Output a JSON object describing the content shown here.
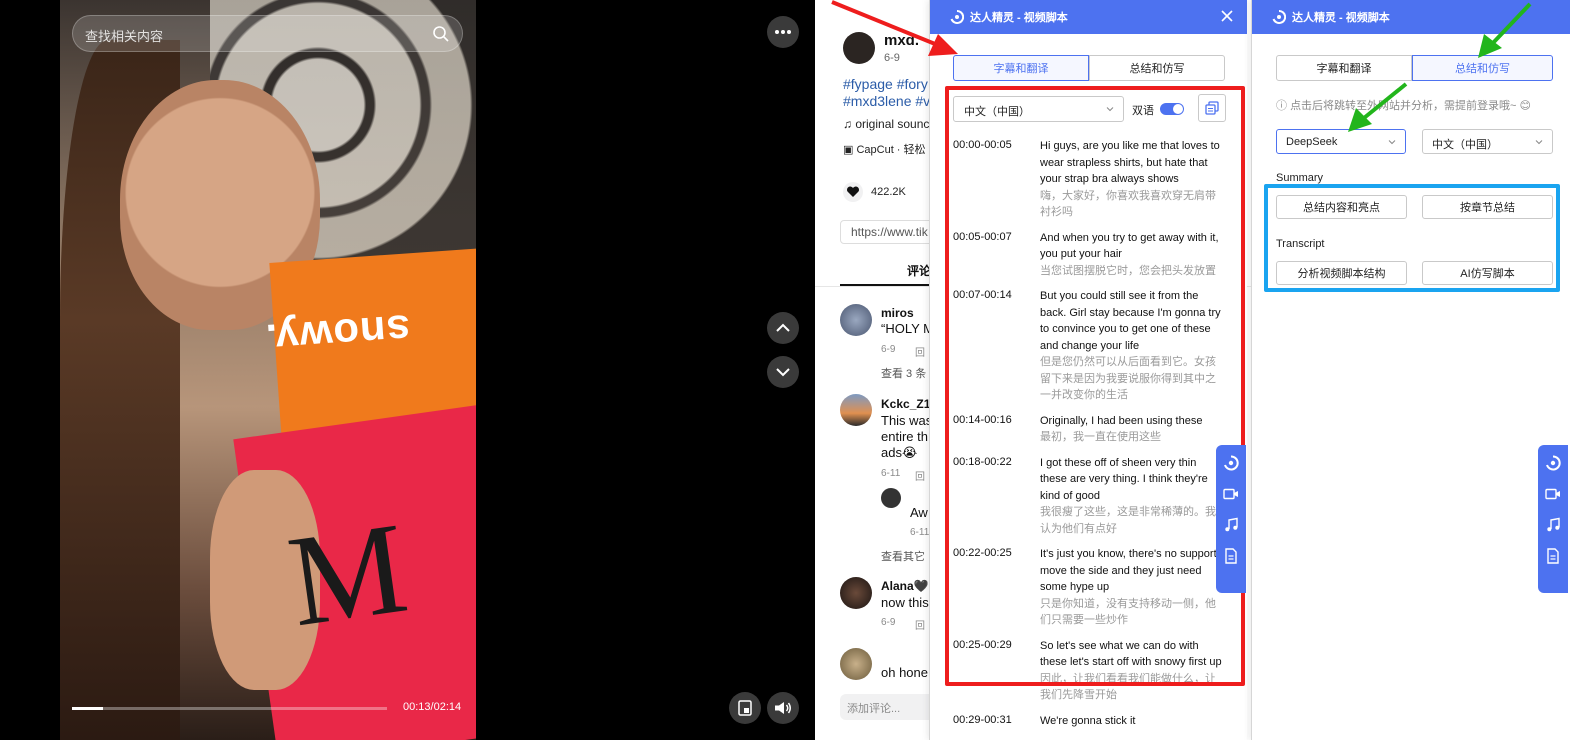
{
  "video": {
    "search_placeholder": "查找相关内容",
    "time": "00:13/02:14",
    "progress": 0.098,
    "orange_box_text": "snowy.",
    "red_box_logo": "M"
  },
  "tiktok": {
    "username": "mxd.",
    "meta": "6-9",
    "tags": "#fypage #fory #mxd3lene #v",
    "sound": "original sounc",
    "capcut": "CapCut · 轻松",
    "likes": "422.2K",
    "url": "https://www.tik",
    "comments_tab": "评论",
    "comments": [
      {
        "name": "miros",
        "text": "“HOLY M",
        "date": "6-9",
        "reply": "回",
        "more": "查看 3 条"
      },
      {
        "name": "Kckc_Z13",
        "text_lines": [
          "This was",
          "entire th",
          "ads😭"
        ],
        "date": "6-11",
        "reply": "回",
        "more": "查看其它"
      },
      {
        "name": "Alana🖤",
        "text": "now this",
        "date": "6-9",
        "reply": "回"
      },
      {
        "name": "",
        "text": "oh hone"
      }
    ],
    "reply": {
      "text": "Aw",
      "date": "6-11"
    },
    "comment_placeholder": "添加评论..."
  },
  "ext_left": {
    "title": "达人精灵 - 视频脚本",
    "tabs": [
      "字幕和翻译",
      "总结和仿写"
    ],
    "active_tab": 0,
    "language": "中文（中国）",
    "bilingual_label": "双语",
    "bilingual_on": true,
    "subtitles": [
      {
        "time": "00:00-00:05",
        "en": "Hi guys, are you like me that loves to wear strapless shirts, but hate that your strap bra always shows",
        "zh": "嗨，大家好，你喜欢我喜欢穿无肩带衬衫吗"
      },
      {
        "time": "00:05-00:07",
        "en": "And when you try to get away with it, you put your hair",
        "zh": "当您试图摆脱它时，您会把头发放置"
      },
      {
        "time": "00:07-00:14",
        "en": "But you could still see it from the back. Girl stay because I'm gonna try to convince you to get one of these and change your life",
        "zh": "但是您仍然可以从后面看到它。女孩留下来是因为我要说服你得到其中之一并改变你的生活"
      },
      {
        "time": "00:14-00:16",
        "en": "Originally, I had been using these",
        "zh": "最初，我一直在使用这些"
      },
      {
        "time": "00:18-00:22",
        "en": "I got these off of sheen very thin these are very thing. I think they're kind of good",
        "zh": "我很瘦了这些，这是非常稀薄的。我认为他们有点好"
      },
      {
        "time": "00:22-00:25",
        "en": "It's just you know, there's no support move the side and they just need some hype up",
        "zh": "只是你知道，没有支持移动一侧，他们只需要一些炒作"
      },
      {
        "time": "00:25-00:29",
        "en": "So let's see what we can do with these let's start off with snowy first up",
        "zh": "因此，让我们看看我们能做什么，让我们先降雪开始"
      },
      {
        "time": "00:29-00:31",
        "en": "We're gonna stick it",
        "zh": ""
      }
    ]
  },
  "ext_right": {
    "title": "达人精灵 - 视频脚本",
    "tabs": [
      "字幕和翻译",
      "总结和仿写"
    ],
    "active_tab": 1,
    "note": "点击后将跳转至外网站并分析，需提前登录哦~ 😊",
    "model": "DeepSeek",
    "language": "中文（中国）",
    "summary_label": "Summary",
    "summary_buttons": [
      "总结内容和亮点",
      "按章节总结"
    ],
    "transcript_label": "Transcript",
    "transcript_buttons": [
      "分析视频脚本结构",
      "AI仿写脚本"
    ]
  },
  "colors": {
    "ext_blue": "#4d72f0",
    "red_annotation": "#ee1d1d",
    "blue_annotation": "#1aa4f0",
    "green_arrow": "#22b51c"
  }
}
